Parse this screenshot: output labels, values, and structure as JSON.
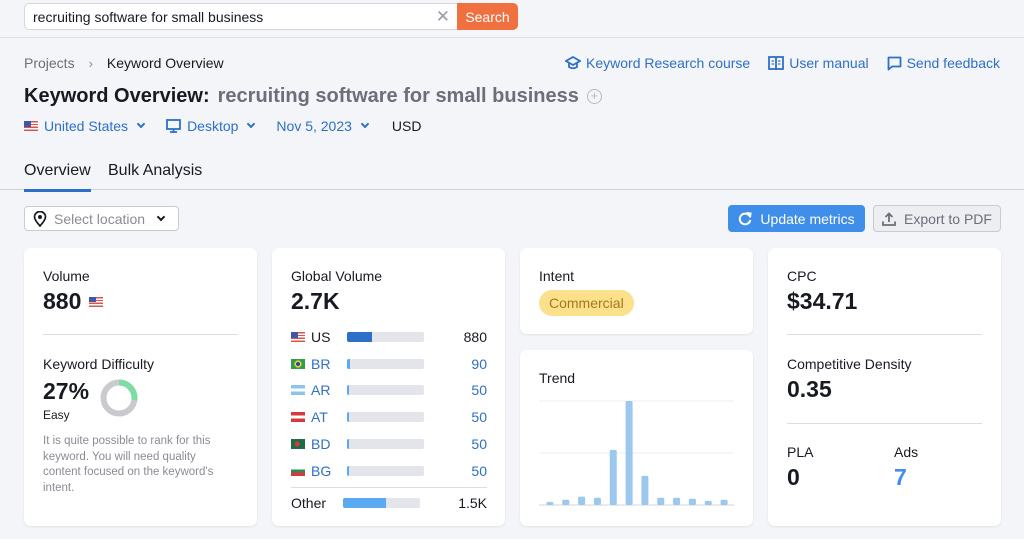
{
  "search": {
    "value": "recruiting software for small business",
    "button_label": "Search",
    "clear_icon": "close-icon"
  },
  "breadcrumb": {
    "items": [
      "Projects",
      "Keyword Overview"
    ]
  },
  "top_links": [
    {
      "label": "Keyword Research course",
      "icon": "graduation-cap-icon"
    },
    {
      "label": "User manual",
      "icon": "book-icon"
    },
    {
      "label": "Send feedback",
      "icon": "message-icon"
    }
  ],
  "header": {
    "title": "Keyword Overview:",
    "keyword": "recruiting software for small business"
  },
  "filters": {
    "country": "United States",
    "device": "Desktop",
    "date": "Nov 5, 2023",
    "currency": "USD"
  },
  "tabs": [
    {
      "label": "Overview",
      "active": true
    },
    {
      "label": "Bulk Analysis",
      "active": false
    }
  ],
  "toolbar": {
    "location_placeholder": "Select location",
    "update_label": "Update metrics",
    "export_label": "Export to PDF"
  },
  "volume_card": {
    "volume_label": "Volume",
    "volume_value": "880",
    "kd_label": "Keyword Difficulty",
    "kd_value": "27%",
    "kd_percent": 27,
    "kd_level": "Easy",
    "kd_description": "It is quite possible to rank for this keyword. You will need quality content focused on the keyword's intent.",
    "colors": {
      "kd_fill": "#7fdca4",
      "kd_track": "#c9cacd"
    }
  },
  "global_volume_card": {
    "label": "Global Volume",
    "value": "2.7K",
    "rows": [
      {
        "code": "US",
        "value": "880",
        "fraction": 0.33,
        "flag": "us"
      },
      {
        "code": "BR",
        "value": "90",
        "fraction": 0.034,
        "flag": "br"
      },
      {
        "code": "AR",
        "value": "50",
        "fraction": 0.02,
        "flag": "ar"
      },
      {
        "code": "AT",
        "value": "50",
        "fraction": 0.02,
        "flag": "at"
      },
      {
        "code": "BD",
        "value": "50",
        "fraction": 0.02,
        "flag": "bd"
      },
      {
        "code": "BG",
        "value": "50",
        "fraction": 0.02,
        "flag": "bg"
      }
    ],
    "other": {
      "label": "Other",
      "value": "1.5K",
      "fraction": 0.56
    }
  },
  "intent_card": {
    "label": "Intent",
    "badge": "Commercial"
  },
  "trend_card": {
    "label": "Trend"
  },
  "chart_data": {
    "type": "bar",
    "title": "Trend",
    "categories": [
      "1",
      "2",
      "3",
      "4",
      "5",
      "6",
      "7",
      "8",
      "9",
      "10",
      "11",
      "12"
    ],
    "values": [
      0.03,
      0.05,
      0.08,
      0.07,
      0.53,
      1.0,
      0.28,
      0.07,
      0.07,
      0.06,
      0.04,
      0.05
    ],
    "ylim": [
      0,
      1
    ],
    "grid": true,
    "xlabel": "",
    "ylabel": ""
  },
  "cpc_card": {
    "cpc_label": "CPC",
    "cpc_value": "$34.71",
    "cd_label": "Competitive Density",
    "cd_value": "0.35",
    "pla_label": "PLA",
    "pla_value": "0",
    "ads_label": "Ads",
    "ads_value": "7"
  }
}
